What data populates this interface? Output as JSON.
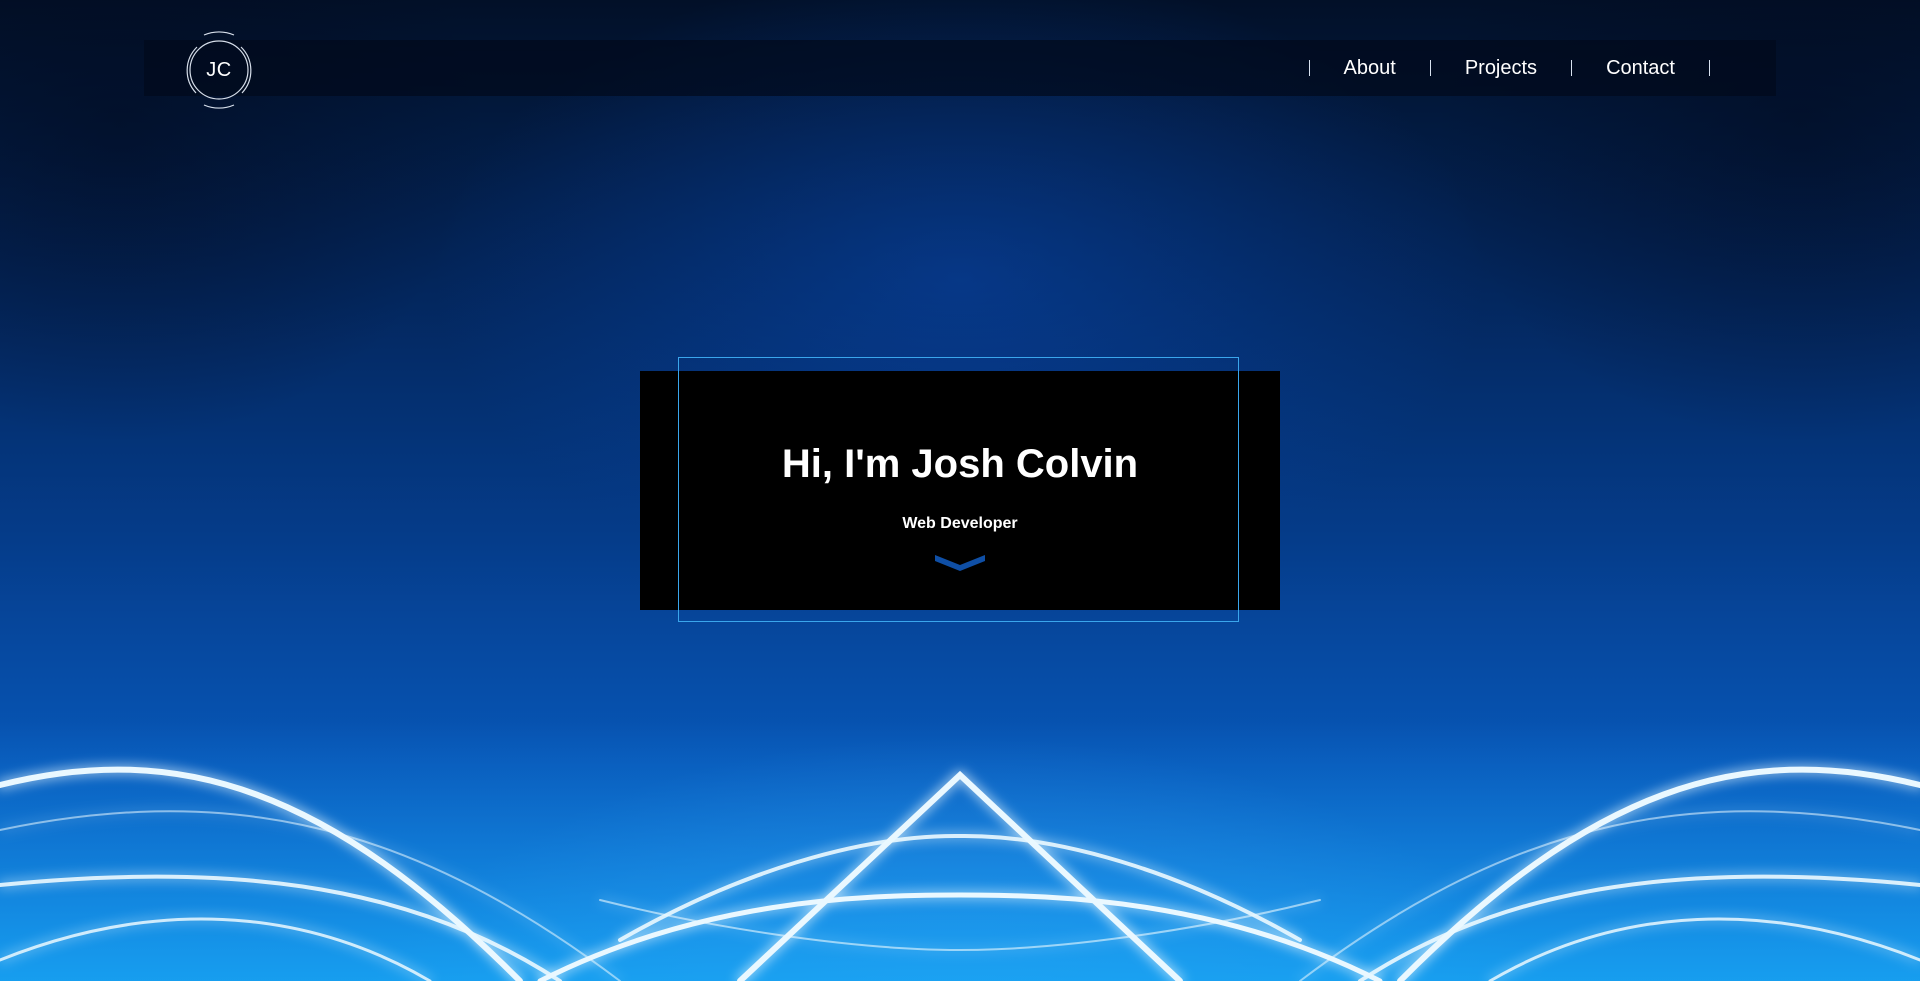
{
  "header": {
    "logo_text": "JC",
    "nav": [
      {
        "label": "About"
      },
      {
        "label": "Projects"
      },
      {
        "label": "Contact"
      }
    ]
  },
  "hero": {
    "title": "Hi, I'm Josh Colvin",
    "subtitle": "Web Developer",
    "scroll_icon": "chevron-down-icon"
  },
  "colors": {
    "accent": "#3aa6ec",
    "hero_box": "#000000",
    "chevron": "#0f4fa6",
    "wave_glow": "#7fd4ff"
  }
}
